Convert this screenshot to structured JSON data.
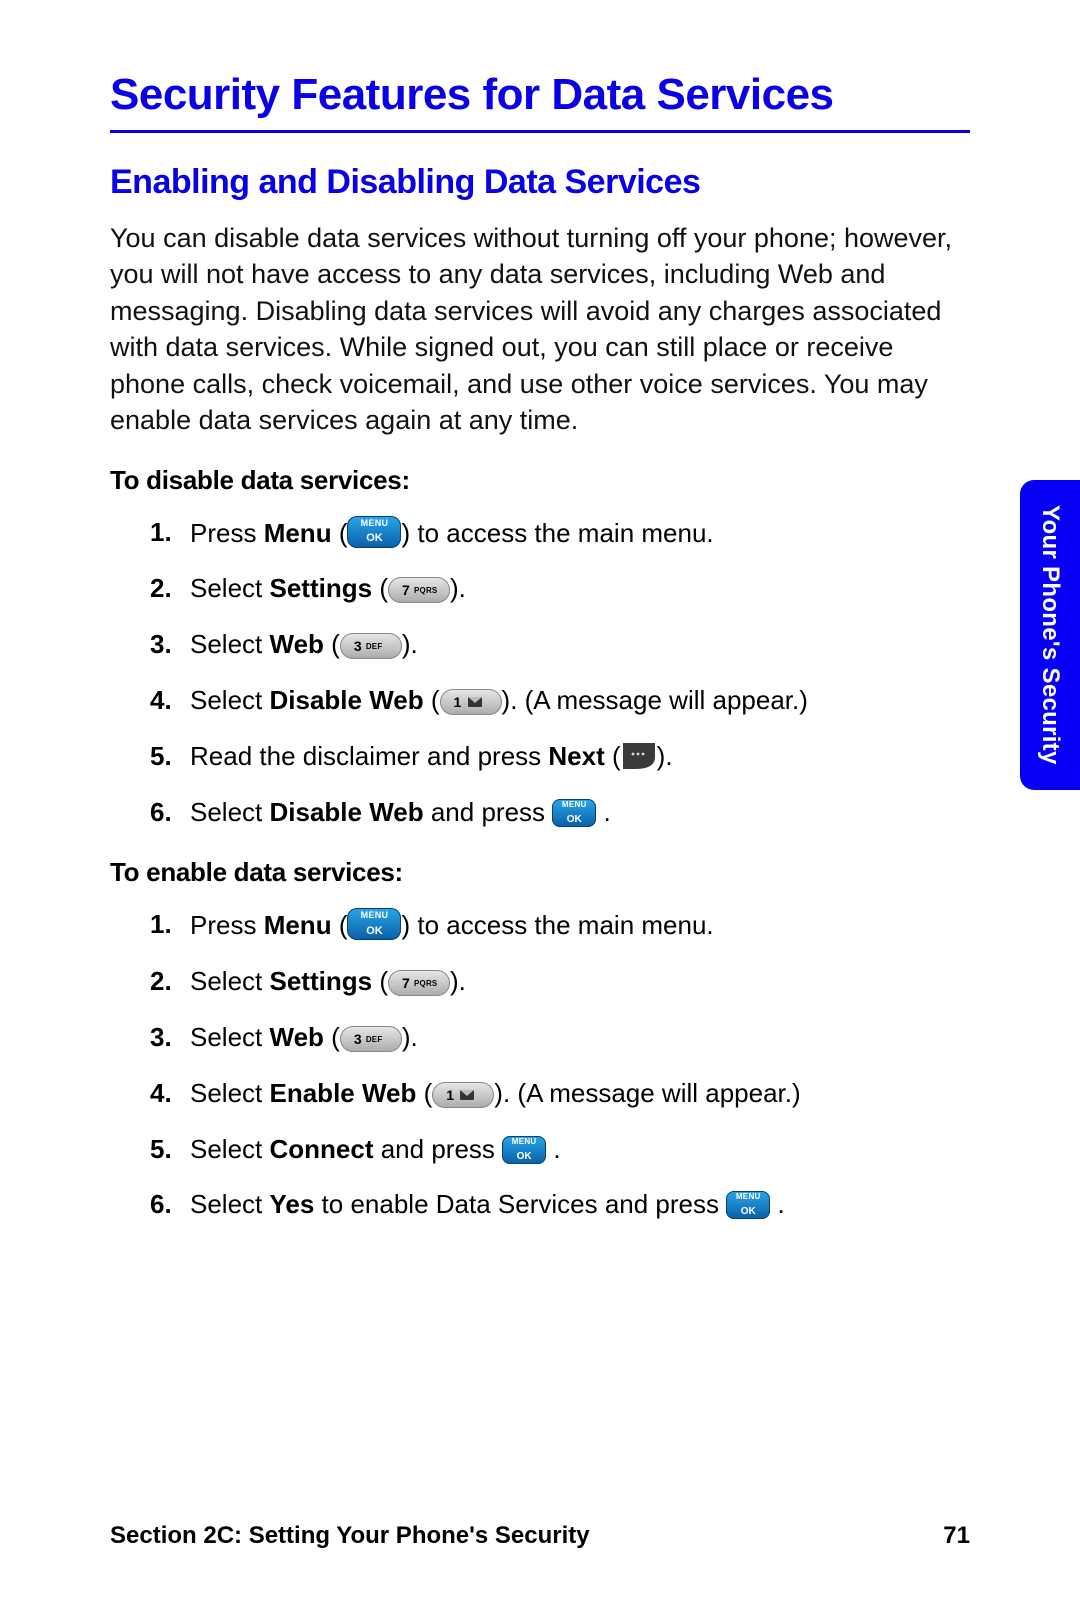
{
  "title": "Security Features for Data Services",
  "subtitle": "Enabling and Disabling Data Services",
  "intro": "You can disable data services without turning off your phone; however, you will not have access to any data services, including Web and messaging. Disabling data services will avoid any charges associated with data services. While signed out, you can still place or receive phone calls, check voicemail, and use other voice services. You may enable data services again at any time.",
  "disable_head": "To disable data services:",
  "enable_head": "To enable data services:",
  "side_tab": "Your Phone's Security",
  "footer_section": "Section 2C: Setting Your Phone's Security",
  "page_number": "71",
  "labels": {
    "press": "Press ",
    "menu": "Menu",
    "to_main_menu": " to access the main menu.",
    "select": "Select ",
    "settings": "Settings",
    "web": "Web",
    "disable_web": "Disable Web",
    "enable_web": "Enable Web",
    "msg_appear": ". (A message will appear.)",
    "read_disclaimer_press": "Read the disclaimer and press ",
    "next": "Next",
    "and_press": " and press ",
    "connect": "Connect",
    "yes": "Yes",
    "to_enable_ds_press": " to enable Data Services and press ",
    "open_paren": " (",
    "close_paren": ")",
    "close_paren_period": ").",
    "period": "."
  },
  "keys": {
    "settings_key": "7",
    "settings_letters": "PQRS",
    "web_key": "3",
    "web_letters": "DEF",
    "one_key": "1"
  }
}
